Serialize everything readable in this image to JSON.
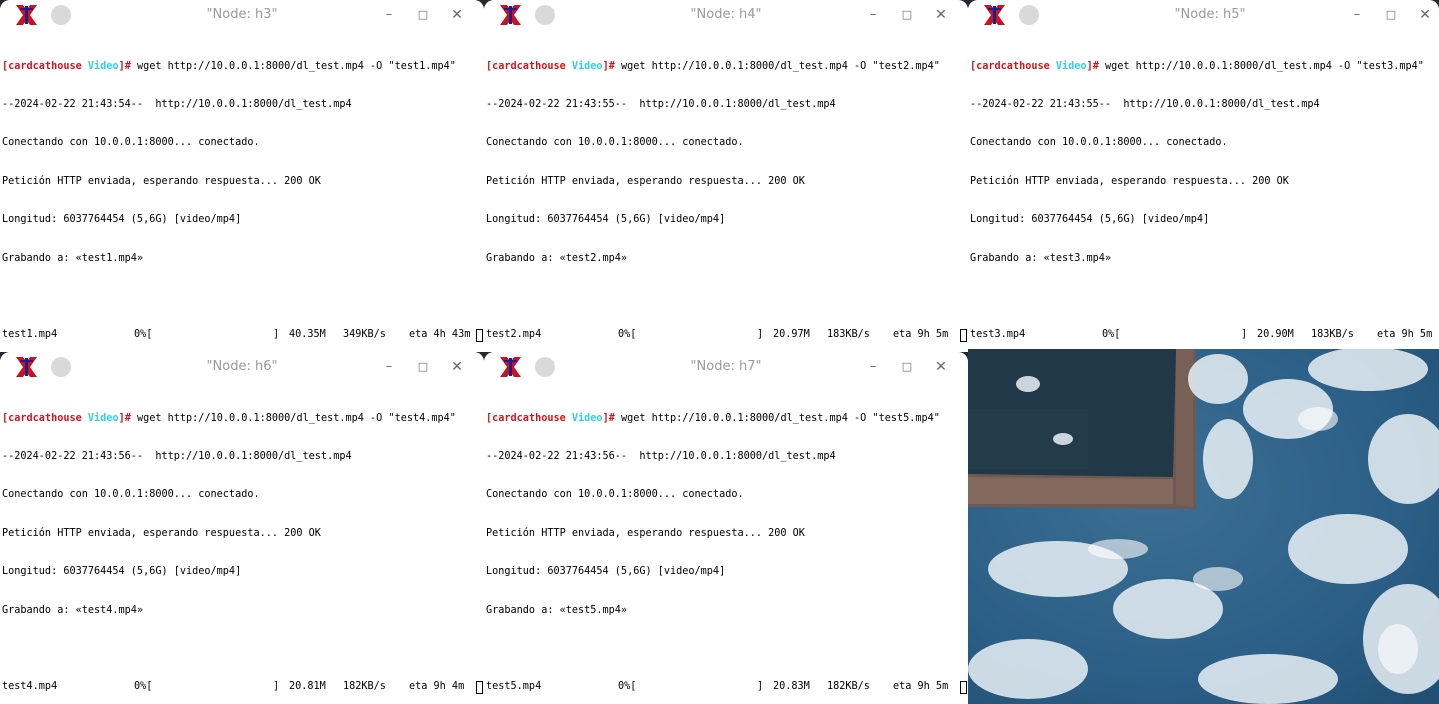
{
  "windows": [
    {
      "title": "\"Node: h3\"",
      "prompt": {
        "open": "[",
        "host": "cardcathouse",
        "space": " ",
        "dir": "Video",
        "close": "]#",
        "cmd": " wget http://10.0.0.1:8000/dl_test.mp4 -O \"test1.mp4\""
      },
      "lines": [
        "--2024-02-22 21:43:54--  http://10.0.0.1:8000/dl_test.mp4",
        "Conectando con 10.0.0.1:8000... conectado.",
        "Petición HTTP enviada, esperando respuesta... 200 OK",
        "Longitud: 6037764454 (5,6G) [video/mp4]",
        "Grabando a: «test1.mp4»"
      ],
      "progress": {
        "file": "test1.mp4",
        "percent": "0%[",
        "bar_end": "]",
        "size": "40.35M",
        "rate": "349KB/s",
        "eta": "eta 4h 43m"
      }
    },
    {
      "title": "\"Node: h4\"",
      "prompt": {
        "open": "[",
        "host": "cardcathouse",
        "space": " ",
        "dir": "Video",
        "close": "]#",
        "cmd": " wget http://10.0.0.1:8000/dl_test.mp4 -O \"test2.mp4\""
      },
      "lines": [
        "--2024-02-22 21:43:55--  http://10.0.0.1:8000/dl_test.mp4",
        "Conectando con 10.0.0.1:8000... conectado.",
        "Petición HTTP enviada, esperando respuesta... 200 OK",
        "Longitud: 6037764454 (5,6G) [video/mp4]",
        "Grabando a: «test2.mp4»"
      ],
      "progress": {
        "file": "test2.mp4",
        "percent": "0%[",
        "bar_end": "]",
        "size": "20.97M",
        "rate": "183KB/s",
        "eta": "eta 9h 5m"
      }
    },
    {
      "title": "\"Node: h5\"",
      "prompt": {
        "open": "[",
        "host": "cardcathouse",
        "space": " ",
        "dir": "Video",
        "close": "]#",
        "cmd": " wget http://10.0.0.1:8000/dl_test.mp4 -O \"test3.mp4\""
      },
      "lines": [
        "--2024-02-22 21:43:55--  http://10.0.0.1:8000/dl_test.mp4",
        "Conectando con 10.0.0.1:8000... conectado.",
        "Petición HTTP enviada, esperando respuesta... 200 OK",
        "Longitud: 6037764454 (5,6G) [video/mp4]",
        "Grabando a: «test3.mp4»"
      ],
      "progress": {
        "file": "test3.mp4",
        "percent": "0%[",
        "bar_end": "]",
        "size": "20.90M",
        "rate": "183KB/s",
        "eta": "eta 9h 5m"
      }
    },
    {
      "title": "\"Node: h6\"",
      "prompt": {
        "open": "[",
        "host": "cardcathouse",
        "space": " ",
        "dir": "Video",
        "close": "]#",
        "cmd": " wget http://10.0.0.1:8000/dl_test.mp4 -O \"test4.mp4\""
      },
      "lines": [
        "--2024-02-22 21:43:56--  http://10.0.0.1:8000/dl_test.mp4",
        "Conectando con 10.0.0.1:8000... conectado.",
        "Petición HTTP enviada, esperando respuesta... 200 OK",
        "Longitud: 6037764454 (5,6G) [video/mp4]",
        "Grabando a: «test4.mp4»"
      ],
      "progress": {
        "file": "test4.mp4",
        "percent": "0%[",
        "bar_end": "]",
        "size": "20.81M",
        "rate": "182KB/s",
        "eta": "eta 9h 4m"
      }
    },
    {
      "title": "\"Node: h7\"",
      "prompt": {
        "open": "[",
        "host": "cardcathouse",
        "space": " ",
        "dir": "Video",
        "close": "]#",
        "cmd": " wget http://10.0.0.1:8000/dl_test.mp4 -O \"test5.mp4\""
      },
      "lines": [
        "--2024-02-22 21:43:56--  http://10.0.0.1:8000/dl_test.mp4",
        "Conectando con 10.0.0.1:8000... conectado.",
        "Petición HTTP enviada, esperando respuesta... 200 OK",
        "Longitud: 6037764454 (5,6G) [video/mp4]",
        "Grabando a: «test5.mp4»"
      ],
      "progress": {
        "file": "test5.mp4",
        "percent": "0%[",
        "bar_end": "]",
        "size": "20.83M",
        "rate": "182KB/s",
        "eta": "eta 9h 5m"
      }
    }
  ],
  "controls": {
    "minimize": "–",
    "maximize": "□",
    "close": "✕"
  },
  "icons": {
    "app": "xterm-x-icon",
    "menu": "window-menu-circle-icon"
  },
  "colors": {
    "prompt_host": "#d4141c",
    "prompt_dir": "#2ad3e6",
    "wallpaper_water": "#2b5e86",
    "wallpaper_foam": "#e9f1f6"
  }
}
